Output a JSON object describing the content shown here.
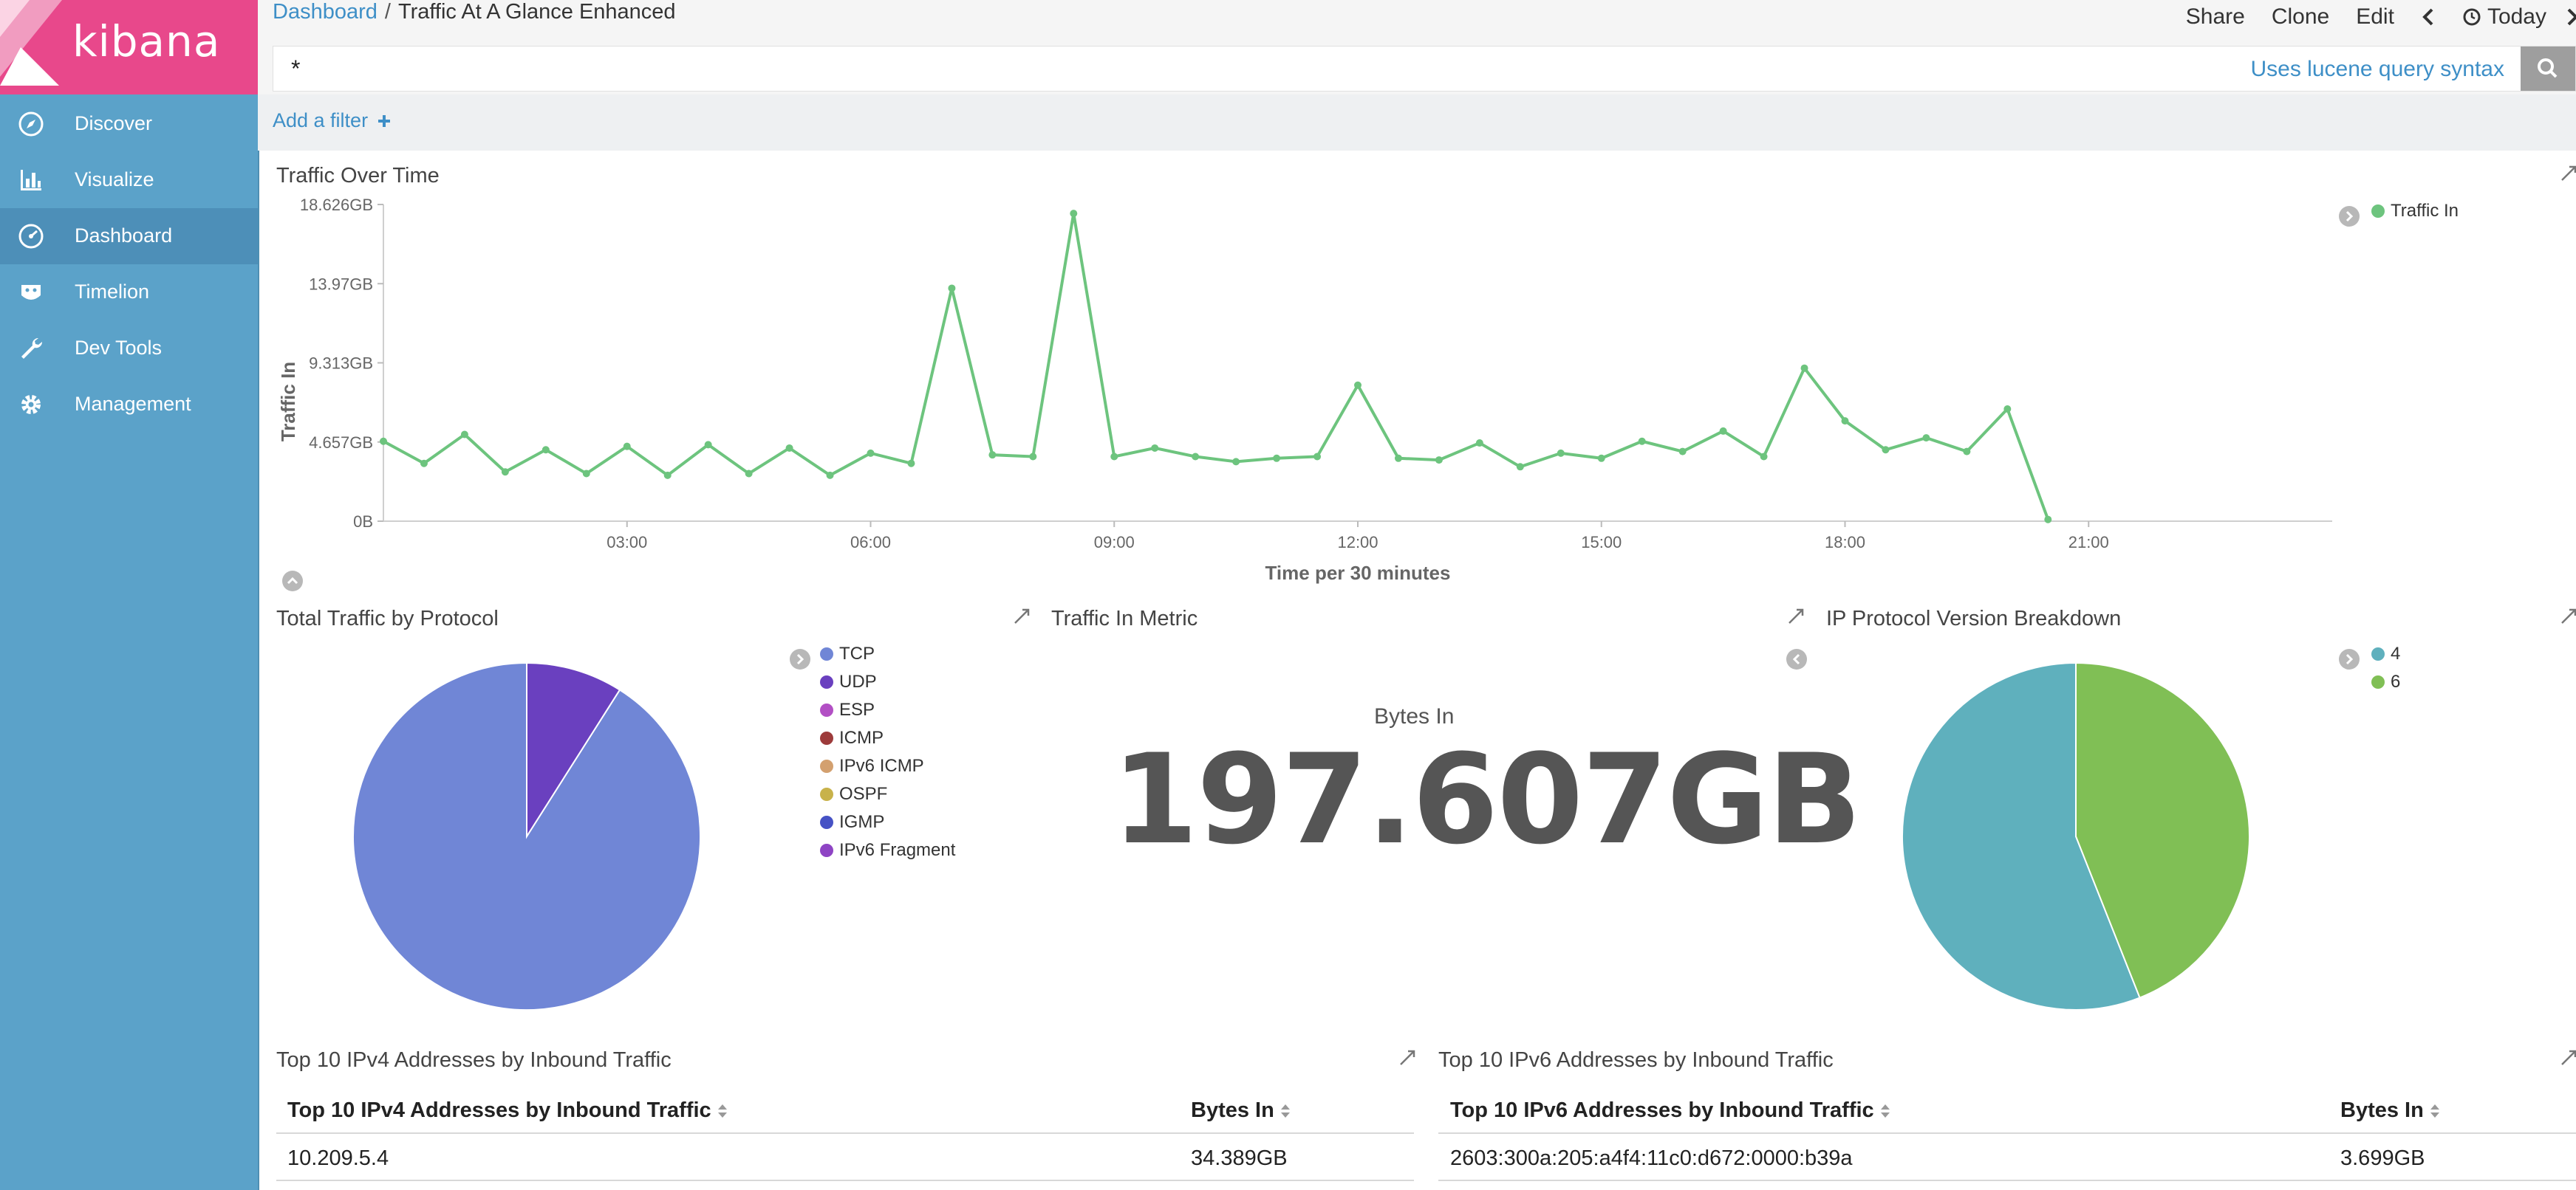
{
  "brand": {
    "name": "kibana"
  },
  "nav": {
    "items": [
      {
        "label": "Discover",
        "icon": "compass-icon"
      },
      {
        "label": "Visualize",
        "icon": "bar-chart-icon"
      },
      {
        "label": "Dashboard",
        "icon": "dashboard-icon",
        "active": true
      },
      {
        "label": "Timelion",
        "icon": "timelion-icon"
      },
      {
        "label": "Dev Tools",
        "icon": "wrench-icon"
      },
      {
        "label": "Management",
        "icon": "gear-icon"
      }
    ]
  },
  "breadcrumb": {
    "parent": "Dashboard",
    "separator": "/",
    "current": "Traffic At A Glance Enhanced"
  },
  "top_actions": {
    "share": "Share",
    "clone": "Clone",
    "edit": "Edit",
    "time": "Today"
  },
  "query": {
    "value": "*",
    "hint": "Uses lucene query syntax"
  },
  "filters": {
    "add_label": "Add a filter"
  },
  "colors": {
    "accent": "#3e8fc7",
    "sidebar": "#5ba2c9",
    "brand": "#e8488b",
    "traffic_line": "#6dc47e",
    "tcp": "#7086d6",
    "udp": "#6a40bf",
    "ipv4": "#5fb0bd",
    "ipv6": "#80bf55"
  },
  "chart_data": [
    {
      "type": "line",
      "title": "Traffic Over Time",
      "xlabel": "Time per 30 minutes",
      "ylabel": "Traffic In",
      "y_unit": "GB",
      "ylim": [
        0,
        18.626
      ],
      "y_ticks": [
        "0B",
        "4.657GB",
        "9.313GB",
        "13.97GB",
        "18.626GB"
      ],
      "x_ticks": [
        "03:00",
        "06:00",
        "09:00",
        "12:00",
        "15:00",
        "18:00",
        "21:00"
      ],
      "xlim_hours": [
        0,
        24
      ],
      "legend_position": "top-right",
      "series": [
        {
          "name": "Traffic In",
          "x_hours": [
            0,
            0.5,
            1,
            1.5,
            2,
            2.5,
            3,
            3.5,
            4,
            4.5,
            5,
            5.5,
            6,
            6.5,
            7,
            7.5,
            8,
            8.5,
            9,
            9.5,
            10,
            10.5,
            11,
            11.5,
            12,
            12.5,
            13,
            13.5,
            14,
            14.5,
            15,
            15.5,
            16,
            16.5,
            17,
            17.5,
            18,
            18.5,
            19,
            19.5,
            20,
            20.5
          ],
          "values": [
            4.7,
            3.4,
            5.1,
            2.9,
            4.2,
            2.8,
            4.4,
            2.7,
            4.5,
            2.8,
            4.3,
            2.7,
            4.0,
            3.4,
            13.7,
            3.9,
            3.8,
            18.1,
            3.8,
            4.3,
            3.8,
            3.5,
            3.7,
            3.8,
            8.0,
            3.7,
            3.6,
            4.6,
            3.2,
            4.0,
            3.7,
            4.7,
            4.1,
            5.3,
            3.8,
            9.0,
            5.9,
            4.2,
            4.9,
            4.1,
            6.6,
            0.1
          ]
        }
      ]
    },
    {
      "type": "pie",
      "title": "Total Traffic by Protocol",
      "legend_position": "right",
      "slices": [
        {
          "label": "TCP",
          "value": 91.0,
          "color": "#7086d6"
        },
        {
          "label": "UDP",
          "value": 9.0,
          "color": "#6a40bf"
        },
        {
          "label": "ESP",
          "value": 0,
          "color": "#b24fc4"
        },
        {
          "label": "ICMP",
          "value": 0,
          "color": "#9d3b3b"
        },
        {
          "label": "IPv6 ICMP",
          "value": 0,
          "color": "#d3a06f"
        },
        {
          "label": "OSPF",
          "value": 0,
          "color": "#c8b24a"
        },
        {
          "label": "IGMP",
          "value": 0,
          "color": "#4652c5"
        },
        {
          "label": "IPv6 Fragment",
          "value": 0,
          "color": "#8e44c4"
        }
      ]
    },
    {
      "type": "pie",
      "title": "IP Protocol Version Breakdown",
      "legend_position": "top-right",
      "slices": [
        {
          "label": "4",
          "value": 56.0,
          "color": "#5fb0bd"
        },
        {
          "label": "6",
          "value": 44.0,
          "color": "#80bf55"
        }
      ]
    }
  ],
  "metric": {
    "title": "Traffic In Metric",
    "label": "Bytes In",
    "value": "197.607GB"
  },
  "ipv4_table": {
    "title": "Top 10 IPv4 Addresses by Inbound Traffic",
    "headers": [
      "Top 10 IPv4 Addresses by Inbound Traffic",
      "Bytes In"
    ],
    "rows": [
      [
        "10.209.5.4",
        "34.389GB"
      ]
    ]
  },
  "ipv6_table": {
    "title": "Top 10 IPv6 Addresses by Inbound Traffic",
    "headers": [
      "Top 10 IPv6 Addresses by Inbound Traffic",
      "Bytes In"
    ],
    "rows": [
      [
        "2603:300a:205:a4f4:11c0:d672:0000:b39a",
        "3.699GB"
      ]
    ]
  }
}
